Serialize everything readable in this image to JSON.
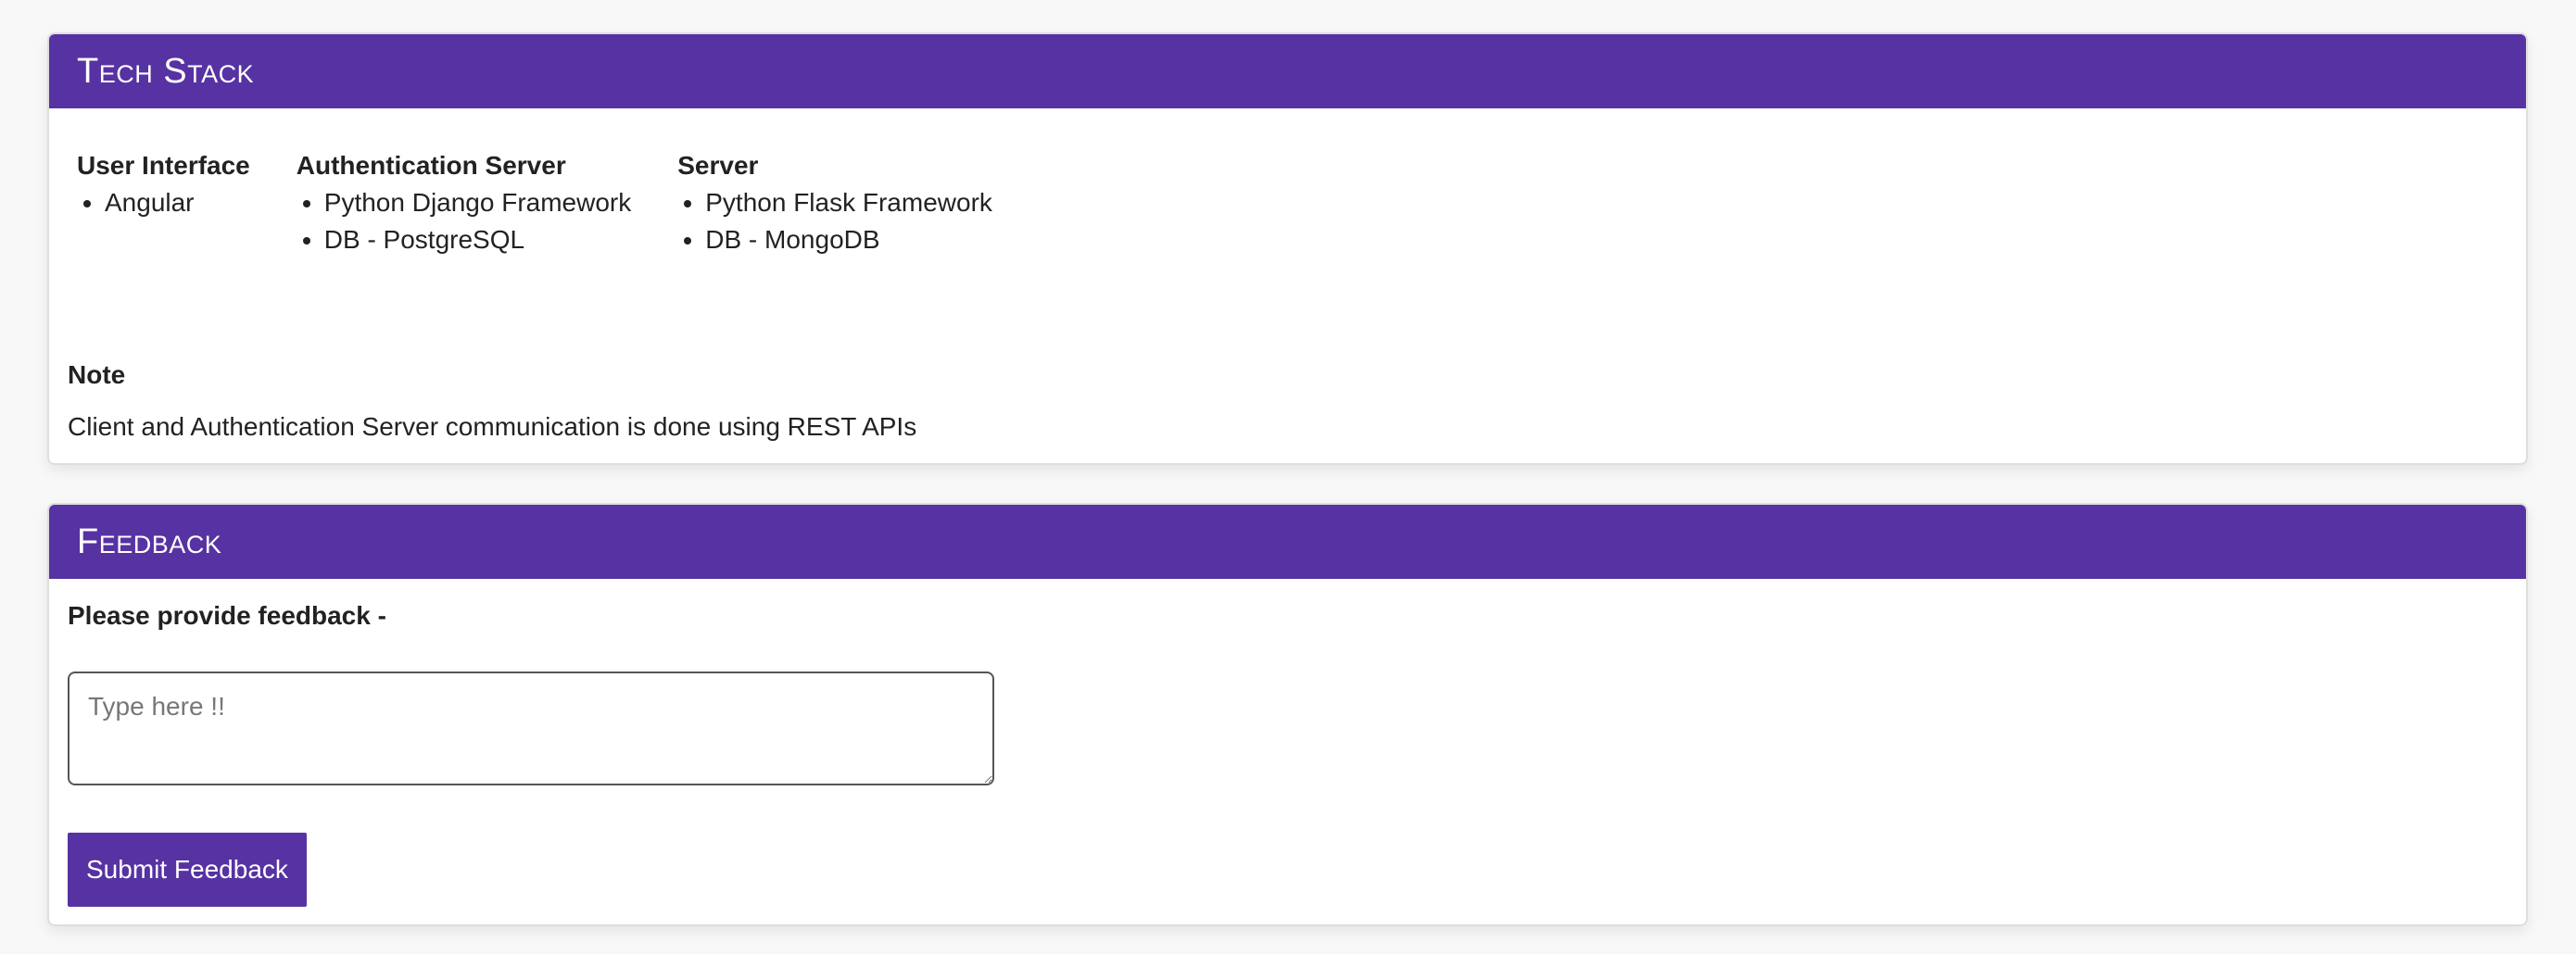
{
  "tech_stack": {
    "title": "Tech Stack",
    "columns": [
      {
        "title": "User Interface",
        "items": [
          "Angular"
        ]
      },
      {
        "title": "Authentication Server",
        "items": [
          "Python Django Framework",
          "DB - PostgreSQL"
        ]
      },
      {
        "title": "Server",
        "items": [
          "Python Flask Framework",
          "DB - MongoDB"
        ]
      }
    ],
    "note_title": "Note",
    "note_text": "Client and Authentication Server communication is done using REST APIs"
  },
  "feedback": {
    "title": "Feedback",
    "prompt": "Please provide feedback -",
    "placeholder": "Type here !!",
    "value": "",
    "submit_label": "Submit Feedback"
  },
  "colors": {
    "accent": "#5732a2",
    "background": "#f8f8f8"
  }
}
